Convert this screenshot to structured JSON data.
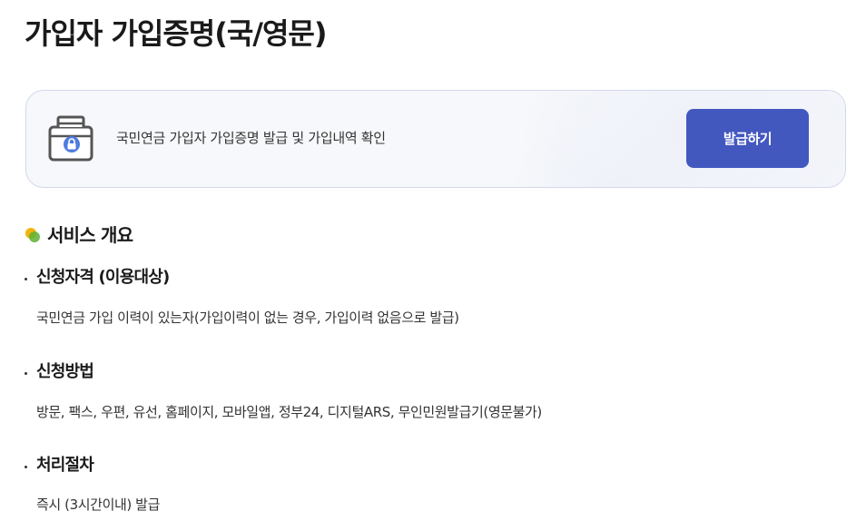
{
  "page": {
    "title": "가입자 가입증명(국/영문)"
  },
  "issue_card": {
    "icon": "locked-document-icon",
    "description": "국민연금 가입자 가입증명 발급 및 가입내역 확인",
    "button_label": "발급하기",
    "button_color": "#4358bf"
  },
  "overview": {
    "icon": "overview-bullet-icon",
    "title": "서비스 개요",
    "items": [
      {
        "heading": "신청자격 (이용대상)",
        "body": "국민연금 가입 이력이 있는자(가입이력이 없는 경우, 가입이력 없음으로 발급)"
      },
      {
        "heading": "신청방법",
        "body": "방문, 팩스, 우편, 유선, 홈페이지, 모바일앱, 정부24, 디지털ARS, 무인민원발급기(영문불가)"
      },
      {
        "heading": "처리절차",
        "body": "즉시 (3시간이내) 발급"
      }
    ]
  }
}
